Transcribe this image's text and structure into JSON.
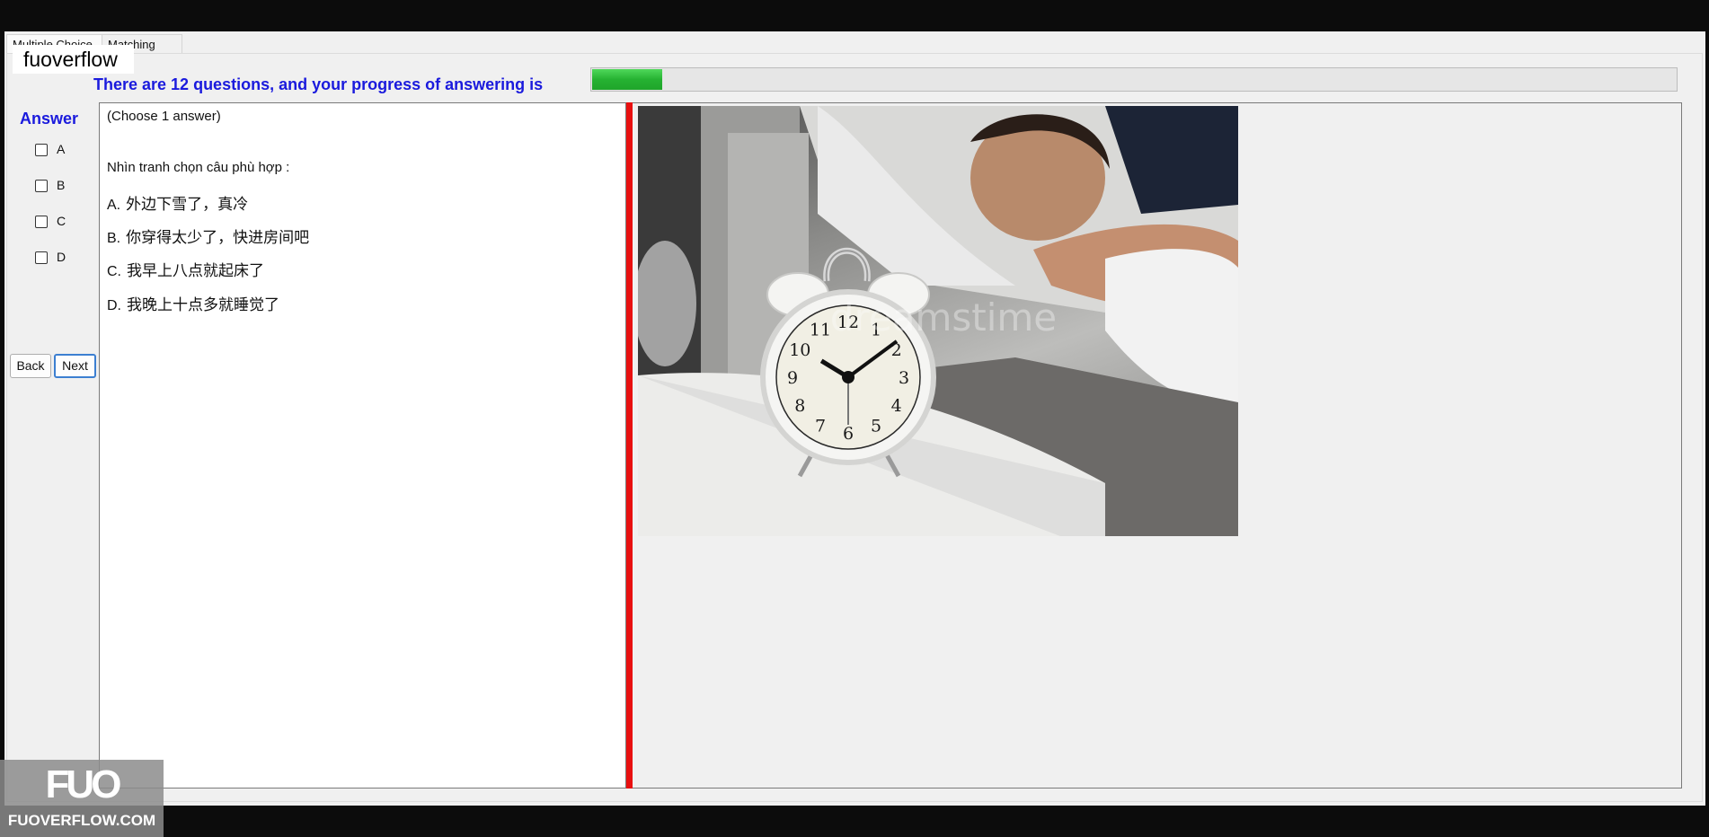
{
  "tabs": {
    "multiple_choice": "Multiple Choice",
    "matching": "Matching"
  },
  "brand_overlay": "fuoverflow",
  "progress": {
    "label": "There are 12 questions, and your progress of answering is",
    "fraction": 0.065
  },
  "answer": {
    "title": "Answer",
    "options": [
      "A",
      "B",
      "C",
      "D"
    ]
  },
  "buttons": {
    "back": "Back",
    "next": "Next"
  },
  "question": {
    "instruction": "(Choose 1 answer)",
    "prompt": "Nhìn tranh chọn câu phù hợp :",
    "choices": [
      {
        "letter": "A.",
        "text": "外边下雪了，真冷"
      },
      {
        "letter": "B.",
        "text": "你穿得太少了，快进房间吧"
      },
      {
        "letter": "C.",
        "text": "我早上八点就起床了"
      },
      {
        "letter": "D.",
        "text": "我晚上十点多就睡觉了"
      }
    ]
  },
  "image": {
    "watermark_text": "dreamstime",
    "clock_numbers": [
      "12",
      "1",
      "2",
      "3",
      "4",
      "5",
      "6",
      "7",
      "8",
      "9",
      "10",
      "11"
    ]
  },
  "site_watermark": {
    "logo": "FUO",
    "text": "FUOVERFLOW.COM"
  },
  "colors": {
    "accent_blue": "#1a1add",
    "progress_green": "#26b232",
    "divider_red": "#e81010"
  }
}
